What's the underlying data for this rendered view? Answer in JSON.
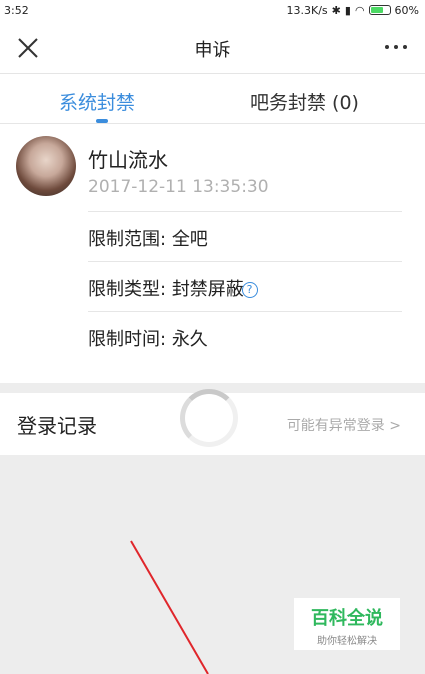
{
  "statusbar": {
    "time": "3:52",
    "speed": "13.3K/s",
    "battery": "60%"
  },
  "navbar": {
    "title": "申诉"
  },
  "tabs": {
    "active": "系统封禁",
    "other": "吧务封禁 (0)"
  },
  "card": {
    "username": "竹山流水",
    "timestamp": "2017-12-11 13:35:30",
    "rows": [
      {
        "label": "限制范围:",
        "value": "全吧"
      },
      {
        "label": "限制类型:",
        "value": "封禁屏蔽"
      },
      {
        "label": "限制时间:",
        "value": "永久"
      }
    ]
  },
  "login": {
    "label": "登录记录",
    "link": "可能有异常登录 >"
  },
  "watermark": {
    "main": "百科全说",
    "sub": "助你轻松解决"
  },
  "colors": {
    "accent": "#3b8ddd",
    "annotation": "#e0262b",
    "watermark": "#2fb85d"
  }
}
